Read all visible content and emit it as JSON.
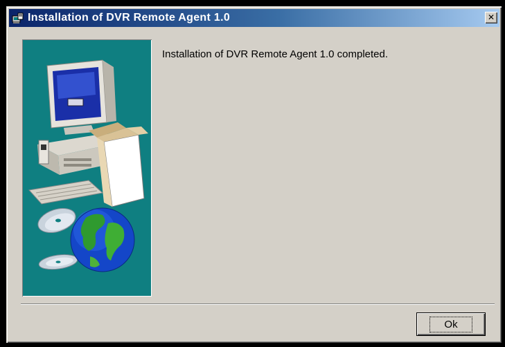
{
  "window": {
    "title": "Installation of DVR Remote Agent 1.0",
    "close_glyph": "✕",
    "title_icon": "installer-icon"
  },
  "main": {
    "message": "Installation of DVR Remote Agent 1.0 completed.",
    "illustration": "computer-and-globe-illustration"
  },
  "footer": {
    "ok_label": "Ok"
  },
  "colors": {
    "titlebar_start": "#0a246a",
    "titlebar_end": "#a6caf0",
    "panel_teal": "#0f7f81",
    "dialog_face": "#d4d0c8"
  }
}
